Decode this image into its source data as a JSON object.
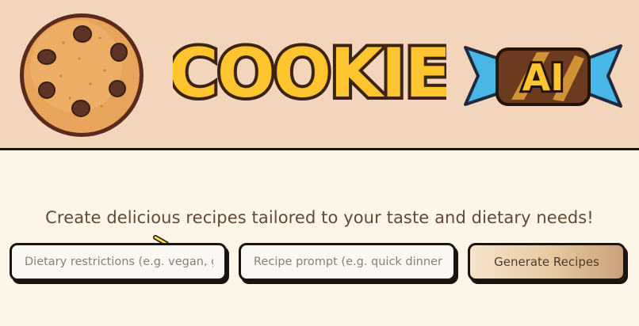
{
  "header": {
    "logo_word": "COOKIE",
    "logo_badge": "AI"
  },
  "main": {
    "tagline": "Create delicious recipes tailored to your taste and dietary needs!",
    "dietary_field": {
      "placeholder": "Dietary restrictions (e.g. vegan, gluten-free)",
      "value": ""
    },
    "prompt_field": {
      "placeholder": "Recipe prompt (e.g. quick dinner)",
      "value": ""
    },
    "generate_label": "Generate Recipes"
  },
  "colors": {
    "header_bg": "#f2d5bb",
    "page_bg": "#fdf6e8",
    "outline": "#1a1410",
    "text": "#5e4a35",
    "cookie": "#e8a45b",
    "logo_yellow": "#ffc52e",
    "candy_blue": "#48b6e6"
  }
}
